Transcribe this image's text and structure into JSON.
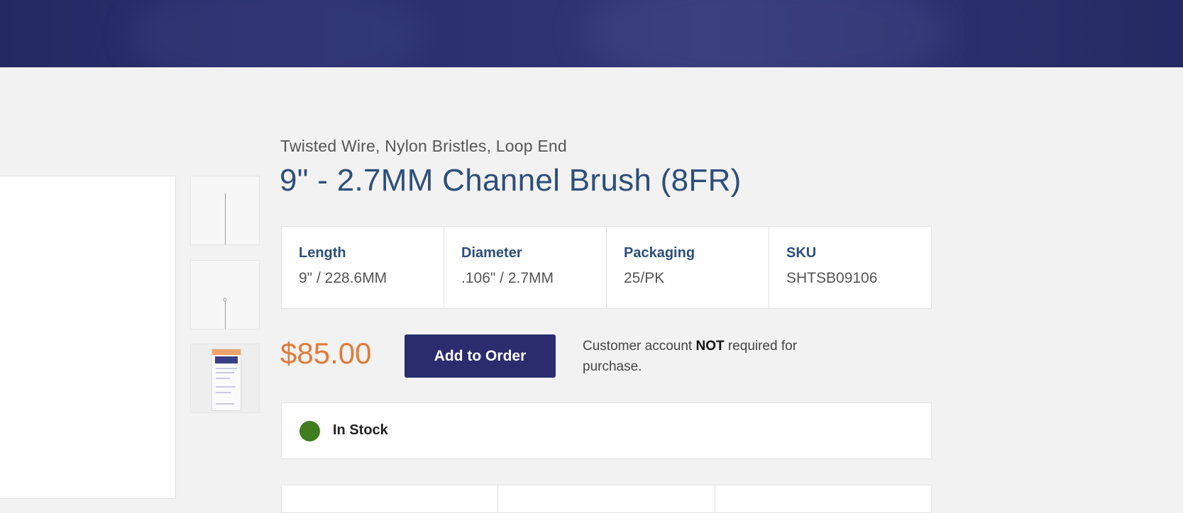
{
  "product": {
    "subtitle": "Twisted Wire, Nylon Bristles, Loop End",
    "title": "9\" - 2.7MM Channel Brush (8FR)",
    "specs": [
      {
        "label": "Length",
        "value": "9\" / 228.6MM"
      },
      {
        "label": "Diameter",
        "value": ".106\" / 2.7MM"
      },
      {
        "label": "Packaging",
        "value": "25/PK"
      },
      {
        "label": "SKU",
        "value": "SHTSB09106"
      }
    ],
    "price": "$85.00",
    "add_button_label": "Add to Order",
    "account_note": {
      "before": "Customer account ",
      "emphasis": "NOT",
      "after": " required for purchase."
    },
    "stock_status": "In Stock",
    "stock_color": "#3f7d1f"
  },
  "colors": {
    "header_bg": "#2a2f6c",
    "title": "#2d4e7a",
    "price": "#e07b3c",
    "button_bg": "#2a2c6e"
  }
}
